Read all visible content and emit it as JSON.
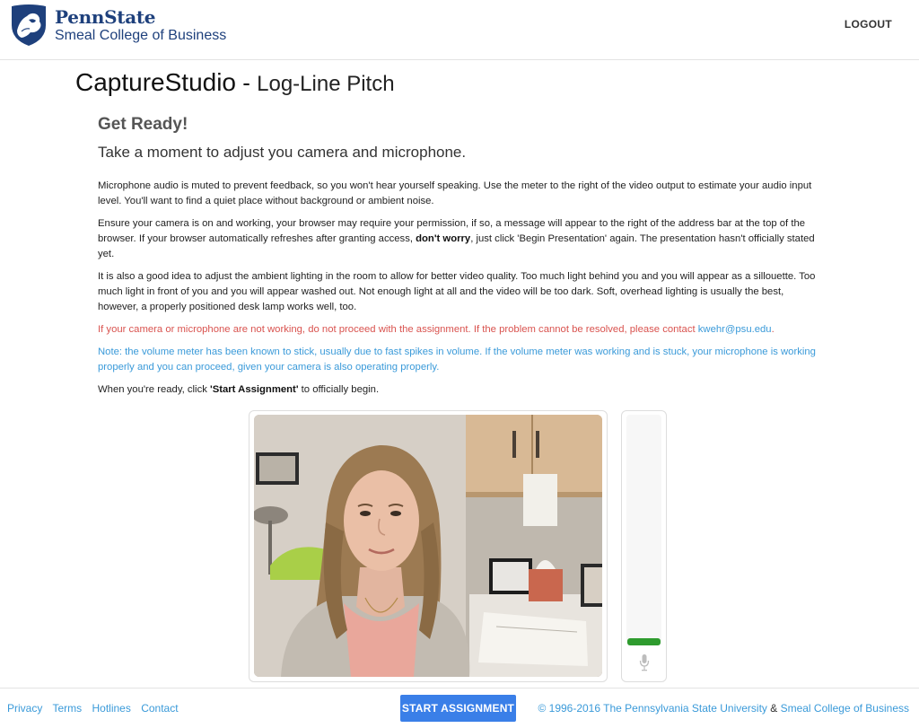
{
  "header": {
    "logo_title": "PennState",
    "logo_subtitle": "Smeal College of Business",
    "logout_label": "LOGOUT"
  },
  "title": {
    "app": "CaptureStudio",
    "separator": " - ",
    "assignment": "Log-Line Pitch"
  },
  "content": {
    "heading": "Get Ready!",
    "subheading": "Take a moment to adjust you camera and microphone.",
    "p1": "Microphone audio is muted to prevent feedback, so you won't hear yourself speaking. Use the meter to the right of the video output to estimate your audio input level. You'll want to find a quiet place without background or ambient noise.",
    "p2_before": "Ensure your camera is on and working, your browser may require your permission, if so, a message will appear to the right of the address bar at the top of the browser. If your browser automatically refreshes after granting access, ",
    "p2_bold": "don't worry",
    "p2_after": ", just click 'Begin Presentation' again. The presentation hasn't officially stated yet.",
    "p3": "It is also a good idea to adjust the ambient lighting in the room to allow for better video quality. Too much light behind you and you will appear as a sillouette. Too much light in front of you and you will appear washed out. Not enough light at all and the video will be too dark. Soft, overhead lighting is usually the best, however, a properly positioned desk lamp works well, too.",
    "warning_text": "If your camera or microphone are not working, do not proceed with the assignment. If the problem cannot be resolved, please contact ",
    "warning_email": "kwehr@psu.edu",
    "warning_end": ".",
    "note": "Note: the volume meter has been known to stick, usually due to fast spikes in volume. If the volume meter was working and is stuck, your microphone is working properly and you can proceed, given your camera is also operating properly.",
    "ready_before": "When you're ready, click ",
    "ready_bold": "'Start Assignment'",
    "ready_after": " to officially begin."
  },
  "meter": {
    "level": 0.03,
    "bar_color": "#2e9b2e",
    "icon": "microphone-icon"
  },
  "footer": {
    "links": [
      "Privacy",
      "Terms",
      "Hotlines",
      "Contact"
    ],
    "start_label": "START ASSIGNMENT",
    "start_color": "#3a7fe8",
    "copyright": "© 1996-2016 The Pennsylvania State University",
    "amp": " & ",
    "college": "Smeal College of Business"
  }
}
